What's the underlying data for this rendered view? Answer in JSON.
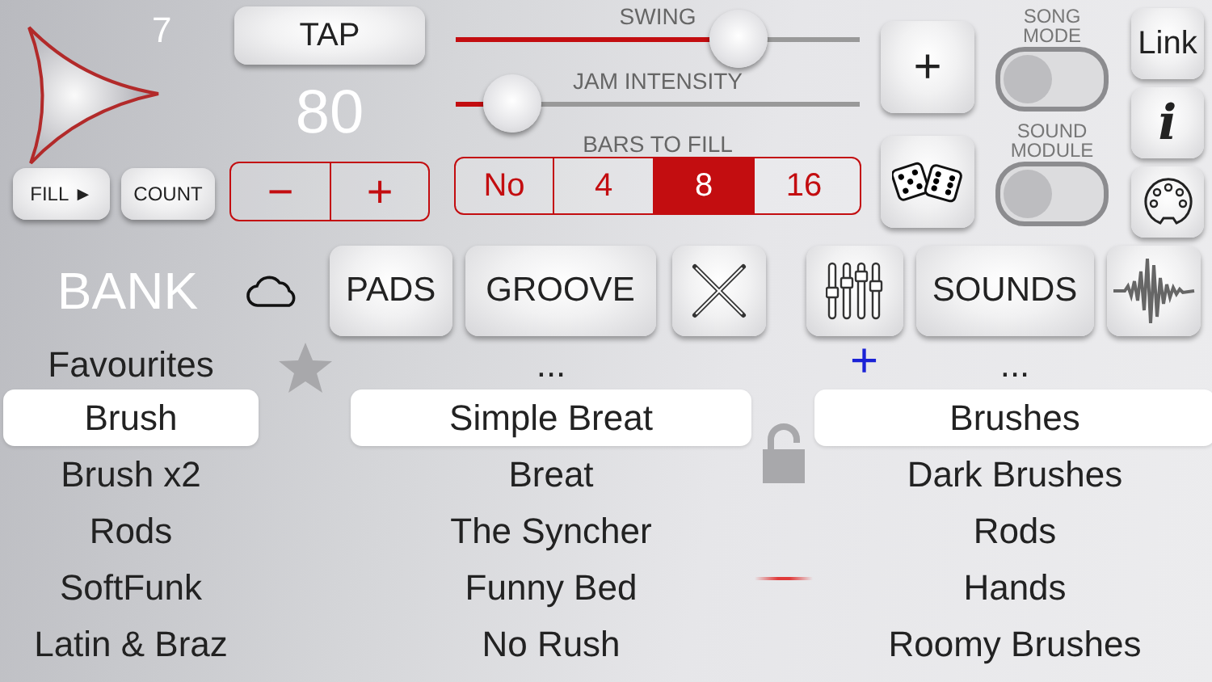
{
  "transport": {
    "bar_count": "7",
    "fill_button": "FILL ►",
    "count_button": "COUNT"
  },
  "tempo": {
    "tap_button": "TAP",
    "bpm": "80",
    "decrement": "−",
    "increment": "+"
  },
  "sliders": [
    {
      "label": "SWING",
      "level": 0.7
    },
    {
      "label": "JAM INTENSITY",
      "level": 0.14
    }
  ],
  "bars_to_fill": {
    "label": "BARS TO FILL",
    "options": [
      {
        "label": "No",
        "selected": false
      },
      {
        "label": "4",
        "selected": false
      },
      {
        "label": "8",
        "selected": true
      },
      {
        "label": "16",
        "selected": false
      }
    ]
  },
  "add_button": "+",
  "toggles": [
    {
      "label": "SONG MODE",
      "on": false
    },
    {
      "label": "SOUND MODULE",
      "on": false
    }
  ],
  "link_button": "Link",
  "info_button": "i",
  "bank_title": "BANK",
  "nav": [
    {
      "kind": "text",
      "label": "PADS"
    },
    {
      "kind": "text",
      "label": "GROOVE"
    },
    {
      "kind": "sticks"
    },
    {
      "kind": "mixer"
    },
    {
      "kind": "text",
      "label": "SOUNDS"
    },
    {
      "kind": "wave"
    }
  ],
  "lists": [
    {
      "header": "Favourites",
      "items": [
        {
          "label": "Brush",
          "selected": true
        },
        {
          "label": "Brush x2",
          "selected": false
        },
        {
          "label": "Rods",
          "selected": false
        },
        {
          "label": "SoftFunk",
          "selected": false
        },
        {
          "label": "Latin & Braz",
          "selected": false
        }
      ]
    },
    {
      "header": "...",
      "items": [
        {
          "label": "Simple Breat",
          "selected": true
        },
        {
          "label": "Breat",
          "selected": false
        },
        {
          "label": "The Syncher",
          "selected": false
        },
        {
          "label": "Funny Bed",
          "selected": false
        },
        {
          "label": "No Rush",
          "selected": false
        }
      ]
    },
    {
      "header": "...",
      "add_sign": "+",
      "items": [
        {
          "label": "Brushes",
          "selected": true
        },
        {
          "label": "Dark Brushes",
          "selected": false
        },
        {
          "label": "Rods",
          "selected": false
        },
        {
          "label": "Hands",
          "selected": false
        },
        {
          "label": "Roomy Brushes",
          "selected": false
        }
      ]
    }
  ]
}
